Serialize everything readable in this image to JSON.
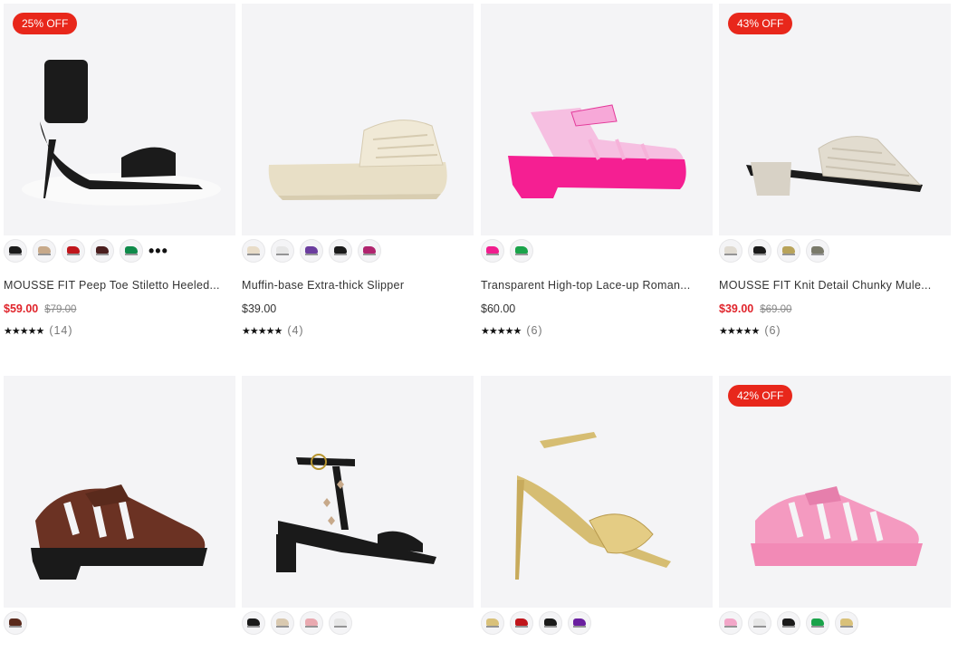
{
  "products": [
    {
      "badge": "25% OFF",
      "name": "MOUSSE FIT Peep Toe Stiletto Heeled...",
      "price": "$59.00",
      "old_price": "$79.00",
      "on_sale": true,
      "rating_count": "(14)",
      "swatch_colors": [
        "#1a1a1a",
        "#c7a98a",
        "#c0151b",
        "#4a1e1e",
        "#0f8a4a"
      ],
      "more": "•••",
      "shoe_color": "#1b1b1b"
    },
    {
      "badge": "",
      "name": "Muffin-base Extra-thick Slipper",
      "price": "$39.00",
      "old_price": "",
      "on_sale": false,
      "rating_count": "(4)",
      "swatch_colors": [
        "#e8dcc8",
        "#e6e6e6",
        "#6b3d9e",
        "#1a1a1a",
        "#b0246e"
      ],
      "more": "",
      "shoe_color": "#ece4d0"
    },
    {
      "badge": "",
      "name": "Transparent High-top Lace-up Roman...",
      "price": "$60.00",
      "old_price": "",
      "on_sale": false,
      "rating_count": "(6)",
      "swatch_colors": [
        "#f01d8e",
        "#1aa34a"
      ],
      "more": "",
      "shoe_color": "#f51f92"
    },
    {
      "badge": "43% OFF",
      "name": "MOUSSE FIT Knit Detail Chunky Mule...",
      "price": "$39.00",
      "old_price": "$69.00",
      "on_sale": true,
      "rating_count": "(6)",
      "swatch_colors": [
        "#e0dbd2",
        "#1a1a1a",
        "#b8a35a",
        "#7a7a6a"
      ],
      "more": "",
      "shoe_color": "#ddd6c8"
    },
    {
      "badge": "",
      "name": "",
      "price": "",
      "old_price": "",
      "on_sale": false,
      "rating_count": "",
      "swatch_colors": [
        "#5a2a1c"
      ],
      "more": "",
      "shoe_color": "#6b3223"
    },
    {
      "badge": "",
      "name": "",
      "price": "",
      "old_price": "",
      "on_sale": false,
      "rating_count": "",
      "swatch_colors": [
        "#1a1a1a",
        "#d9c9b0",
        "#e9a9b0",
        "#e6e6e6"
      ],
      "more": "",
      "shoe_color": "#1a1a1a"
    },
    {
      "badge": "",
      "name": "",
      "price": "",
      "old_price": "",
      "on_sale": false,
      "rating_count": "",
      "swatch_colors": [
        "#d9c17a",
        "#c0151b",
        "#1a1a1a",
        "#6a1fa0"
      ],
      "more": "",
      "shoe_color": "#d6bd72"
    },
    {
      "badge": "42% OFF",
      "name": "",
      "price": "",
      "old_price": "",
      "on_sale": false,
      "rating_count": "",
      "swatch_colors": [
        "#f2a6c8",
        "#e6e6e6",
        "#1a1a1a",
        "#1aa34a",
        "#d9c17a"
      ],
      "more": "",
      "shoe_color": "#f49ac0"
    }
  ],
  "stars": "★★★★★",
  "colors": {
    "sale": "#e0242b",
    "badge": "#e8271b",
    "tile_bg": "#f4f4f6"
  }
}
